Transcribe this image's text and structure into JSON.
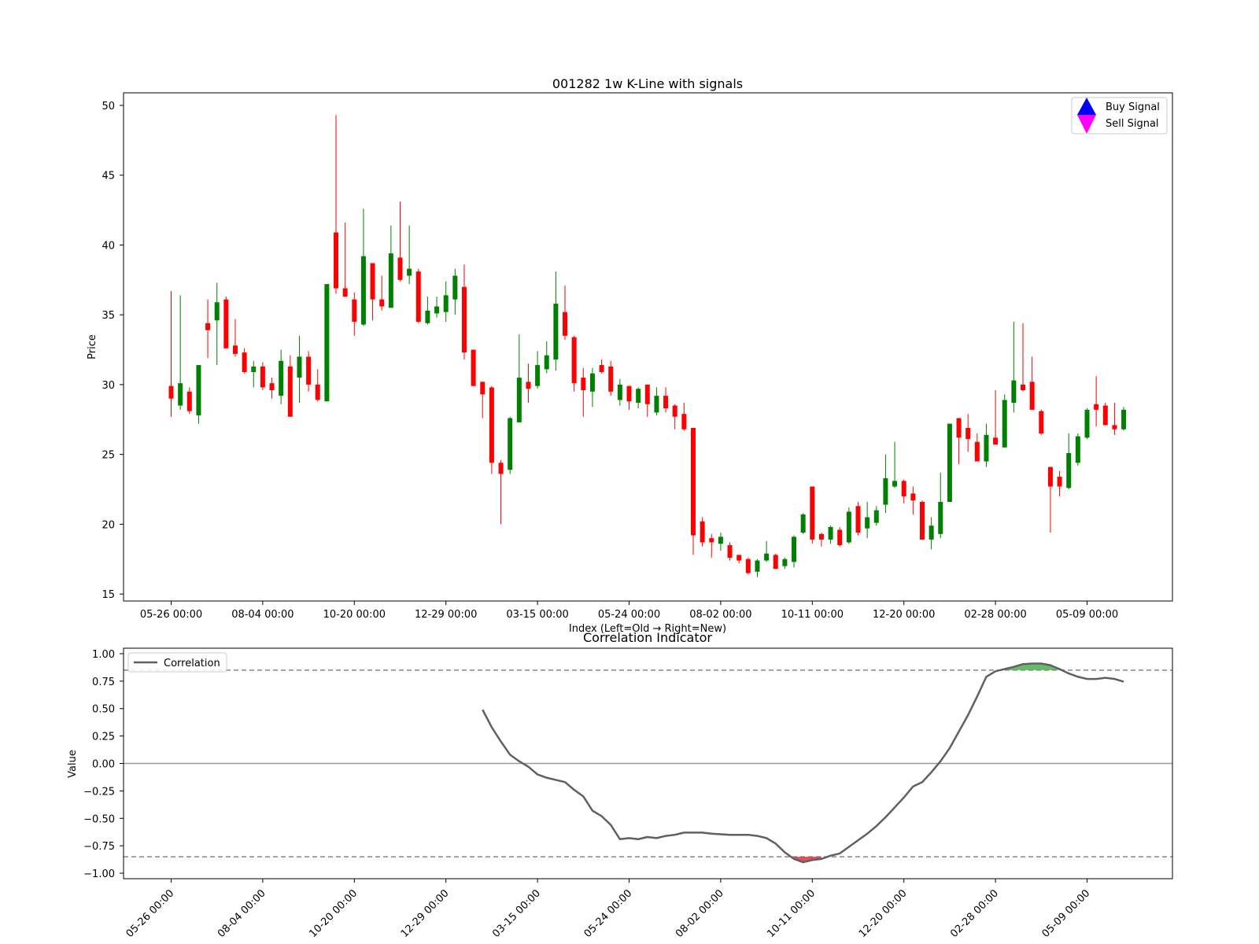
{
  "chart_data": [
    {
      "type": "candlestick",
      "title": "001282 1w K-Line with signals",
      "xlabel": "Index (Left=Old → Right=New)",
      "ylabel": "Price",
      "ylim": [
        14.5,
        50.9
      ],
      "yticks": [
        15,
        20,
        25,
        30,
        35,
        40,
        45,
        50
      ],
      "x_tick_labels": [
        {
          "index": 0,
          "label": "05-26 00:00"
        },
        {
          "index": 10,
          "label": "08-04 00:00"
        },
        {
          "index": 20,
          "label": "10-20 00:00"
        },
        {
          "index": 30,
          "label": "12-29 00:00"
        },
        {
          "index": 40,
          "label": "03-15 00:00"
        },
        {
          "index": 50,
          "label": "05-24 00:00"
        },
        {
          "index": 60,
          "label": "08-02 00:00"
        },
        {
          "index": 70,
          "label": "10-11 00:00"
        },
        {
          "index": 80,
          "label": "12-20 00:00"
        },
        {
          "index": 90,
          "label": "02-28 00:00"
        },
        {
          "index": 100,
          "label": "05-09 00:00"
        }
      ],
      "up_color": "#008000",
      "down_color": "#ff0000",
      "candles": [
        [
          29.9,
          36.7,
          27.7,
          29.0
        ],
        [
          28.5,
          36.4,
          28.2,
          30.1
        ],
        [
          29.5,
          29.8,
          27.9,
          28.1
        ],
        [
          27.8,
          31.4,
          27.2,
          31.4
        ],
        [
          34.4,
          36.1,
          31.9,
          33.9
        ],
        [
          34.6,
          37.3,
          31.4,
          35.9
        ],
        [
          36.1,
          36.3,
          32.6,
          32.6
        ],
        [
          32.8,
          34.7,
          32.0,
          32.2
        ],
        [
          32.3,
          32.6,
          30.8,
          30.9
        ],
        [
          30.9,
          31.7,
          29.8,
          31.3
        ],
        [
          31.3,
          31.6,
          29.6,
          29.8
        ],
        [
          30.1,
          30.5,
          29.0,
          29.6
        ],
        [
          29.2,
          32.5,
          28.6,
          31.7
        ],
        [
          31.3,
          32.1,
          27.7,
          27.7
        ],
        [
          30.5,
          33.5,
          28.7,
          32.0
        ],
        [
          32.0,
          32.4,
          29.5,
          30.0
        ],
        [
          30.0,
          31.1,
          28.8,
          28.9
        ],
        [
          28.8,
          37.2,
          28.8,
          37.2
        ],
        [
          40.9,
          49.3,
          36.5,
          36.9
        ],
        [
          36.9,
          41.6,
          36.3,
          36.3
        ],
        [
          36.1,
          36.6,
          33.5,
          34.5
        ],
        [
          34.3,
          42.6,
          34.2,
          39.2
        ],
        [
          38.7,
          38.7,
          34.6,
          36.1
        ],
        [
          36.1,
          37.8,
          35.3,
          35.6
        ],
        [
          35.5,
          41.4,
          35.5,
          39.4
        ],
        [
          39.1,
          43.1,
          37.4,
          37.5
        ],
        [
          37.8,
          41.4,
          37.2,
          38.3
        ],
        [
          38.1,
          38.3,
          34.4,
          34.5
        ],
        [
          34.4,
          36.3,
          34.3,
          35.3
        ],
        [
          35.1,
          36.3,
          34.8,
          35.6
        ],
        [
          35.2,
          37.4,
          34.5,
          36.4
        ],
        [
          36.1,
          38.3,
          35.0,
          37.8
        ],
        [
          37.0,
          38.6,
          31.8,
          32.3
        ],
        [
          32.5,
          32.5,
          29.9,
          29.9
        ],
        [
          30.2,
          30.2,
          27.6,
          29.3
        ],
        [
          29.8,
          29.9,
          23.6,
          24.4
        ],
        [
          24.4,
          24.6,
          20.0,
          23.6
        ],
        [
          23.9,
          27.7,
          23.6,
          27.6
        ],
        [
          27.3,
          33.6,
          27.3,
          30.5
        ],
        [
          30.2,
          31.5,
          28.7,
          29.7
        ],
        [
          29.9,
          32.4,
          29.7,
          31.4
        ],
        [
          31.1,
          33.1,
          30.8,
          32.1
        ],
        [
          31.8,
          38.1,
          31.0,
          35.8
        ],
        [
          35.2,
          37.1,
          33.2,
          33.5
        ],
        [
          33.4,
          33.5,
          29.5,
          30.1
        ],
        [
          30.5,
          31.2,
          27.7,
          29.6
        ],
        [
          29.5,
          31.2,
          28.4,
          30.8
        ],
        [
          31.4,
          31.8,
          30.8,
          30.9
        ],
        [
          31.3,
          31.7,
          29.2,
          29.5
        ],
        [
          28.9,
          30.4,
          28.5,
          30.0
        ],
        [
          29.9,
          29.9,
          28.2,
          28.8
        ],
        [
          28.7,
          29.8,
          28.3,
          29.7
        ],
        [
          30.0,
          30.0,
          27.7,
          28.6
        ],
        [
          28.0,
          29.8,
          27.8,
          29.2
        ],
        [
          29.2,
          29.8,
          28.0,
          28.3
        ],
        [
          28.5,
          28.6,
          26.8,
          27.7
        ],
        [
          27.9,
          28.7,
          26.7,
          26.8
        ],
        [
          26.9,
          26.9,
          17.8,
          19.2
        ],
        [
          20.2,
          20.5,
          18.4,
          18.7
        ],
        [
          19.0,
          19.3,
          17.6,
          18.7
        ],
        [
          18.6,
          19.4,
          18.1,
          19.1
        ],
        [
          18.5,
          18.7,
          17.4,
          17.6
        ],
        [
          17.8,
          17.8,
          17.2,
          17.4
        ],
        [
          17.5,
          17.6,
          16.4,
          16.5
        ],
        [
          16.6,
          17.5,
          16.2,
          17.4
        ],
        [
          17.4,
          18.8,
          17.3,
          17.9
        ],
        [
          17.8,
          17.9,
          16.8,
          16.8
        ],
        [
          17.0,
          17.6,
          16.8,
          17.5
        ],
        [
          17.3,
          19.2,
          16.9,
          19.1
        ],
        [
          19.4,
          20.8,
          19.3,
          20.7
        ],
        [
          22.7,
          22.7,
          18.6,
          18.9
        ],
        [
          19.3,
          19.4,
          18.4,
          18.9
        ],
        [
          18.9,
          19.9,
          18.6,
          19.8
        ],
        [
          19.6,
          19.8,
          18.4,
          18.5
        ],
        [
          18.7,
          21.2,
          18.6,
          20.9
        ],
        [
          21.3,
          21.6,
          19.2,
          19.4
        ],
        [
          19.7,
          21.6,
          19.0,
          20.5
        ],
        [
          20.1,
          21.3,
          19.9,
          21.0
        ],
        [
          21.4,
          25.0,
          20.8,
          23.3
        ],
        [
          22.7,
          25.9,
          22.6,
          23.1
        ],
        [
          23.1,
          23.2,
          21.5,
          22.0
        ],
        [
          22.2,
          22.7,
          20.7,
          21.7
        ],
        [
          21.6,
          21.7,
          18.9,
          18.9
        ],
        [
          18.9,
          20.5,
          18.2,
          19.9
        ],
        [
          19.3,
          23.7,
          19.0,
          21.6
        ],
        [
          21.6,
          27.2,
          21.6,
          27.2
        ],
        [
          27.6,
          27.6,
          24.3,
          26.2
        ],
        [
          26.9,
          27.9,
          25.2,
          26.1
        ],
        [
          25.9,
          26.5,
          24.5,
          24.5
        ],
        [
          24.5,
          27.2,
          24.1,
          26.4
        ],
        [
          26.2,
          29.6,
          25.7,
          25.7
        ],
        [
          25.5,
          29.3,
          25.5,
          28.9
        ],
        [
          28.7,
          34.5,
          28.0,
          30.3
        ],
        [
          30.0,
          34.4,
          29.5,
          29.6
        ],
        [
          30.2,
          32.0,
          28.2,
          28.2
        ],
        [
          28.1,
          28.2,
          26.4,
          26.5
        ],
        [
          24.1,
          24.1,
          19.4,
          22.7
        ],
        [
          23.4,
          23.8,
          22.0,
          22.7
        ],
        [
          22.6,
          26.5,
          22.5,
          25.1
        ],
        [
          24.4,
          26.5,
          24.2,
          26.3
        ],
        [
          26.2,
          28.3,
          26.1,
          28.2
        ],
        [
          28.6,
          30.6,
          27.0,
          28.2
        ],
        [
          28.5,
          28.7,
          27.1,
          27.1
        ],
        [
          27.1,
          28.7,
          26.4,
          26.8
        ],
        [
          26.8,
          28.4,
          26.7,
          28.2
        ]
      ],
      "legend": {
        "position": "upper right",
        "entries": [
          {
            "label": "Buy Signal",
            "marker": "triangle-up",
            "color": "#0000ff"
          },
          {
            "label": "Sell Signal",
            "marker": "triangle-down",
            "color": "#ff00ff"
          }
        ]
      }
    },
    {
      "type": "line",
      "title": "Correlation Indicator",
      "xlabel": "",
      "ylabel": "Value",
      "ylim": [
        -1.05,
        1.05
      ],
      "yticks": [
        1.0,
        0.75,
        0.5,
        0.25,
        0.0,
        -0.25,
        -0.5,
        -0.75,
        -1.0
      ],
      "ytick_labels": [
        "1.00",
        "0.75",
        "0.50",
        "0.25",
        "0.00",
        "−0.25",
        "−0.50",
        "−0.75",
        "−1.00"
      ],
      "x_tick_labels": [
        {
          "index": 0,
          "label": "05-26 00:00"
        },
        {
          "index": 10,
          "label": "08-04 00:00"
        },
        {
          "index": 20,
          "label": "10-20 00:00"
        },
        {
          "index": 30,
          "label": "12-29 00:00"
        },
        {
          "index": 40,
          "label": "03-15 00:00"
        },
        {
          "index": 50,
          "label": "05-24 00:00"
        },
        {
          "index": 60,
          "label": "08-02 00:00"
        },
        {
          "index": 70,
          "label": "10-11 00:00"
        },
        {
          "index": 80,
          "label": "12-20 00:00"
        },
        {
          "index": 90,
          "label": "02-28 00:00"
        },
        {
          "index": 100,
          "label": "05-09 00:00"
        }
      ],
      "thresholds": {
        "upper": 0.85,
        "lower": -0.85,
        "zero": 0.0
      },
      "line_color": "#606060",
      "fill_high_color": "#4caf50",
      "fill_low_color": "#e0303a",
      "series": [
        {
          "name": "Correlation",
          "start_index": 34,
          "values": [
            0.49,
            0.33,
            0.2,
            0.08,
            0.02,
            -0.03,
            -0.1,
            -0.13,
            -0.15,
            -0.17,
            -0.24,
            -0.3,
            -0.43,
            -0.48,
            -0.56,
            -0.69,
            -0.68,
            -0.69,
            -0.67,
            -0.68,
            -0.66,
            -0.65,
            -0.63,
            -0.63,
            -0.63,
            -0.64,
            -0.645,
            -0.65,
            -0.65,
            -0.65,
            -0.66,
            -0.68,
            -0.73,
            -0.81,
            -0.87,
            -0.9,
            -0.88,
            -0.87,
            -0.84,
            -0.82,
            -0.76,
            -0.7,
            -0.64,
            -0.57,
            -0.49,
            -0.4,
            -0.31,
            -0.21,
            -0.17,
            -0.08,
            0.02,
            0.14,
            0.29,
            0.44,
            0.61,
            0.79,
            0.84,
            0.86,
            0.88,
            0.905,
            0.91,
            0.91,
            0.895,
            0.86,
            0.82,
            0.79,
            0.77,
            0.77,
            0.78,
            0.77,
            0.745
          ]
        }
      ],
      "legend": {
        "position": "upper left",
        "entries": [
          {
            "label": "Correlation"
          }
        ]
      }
    }
  ]
}
